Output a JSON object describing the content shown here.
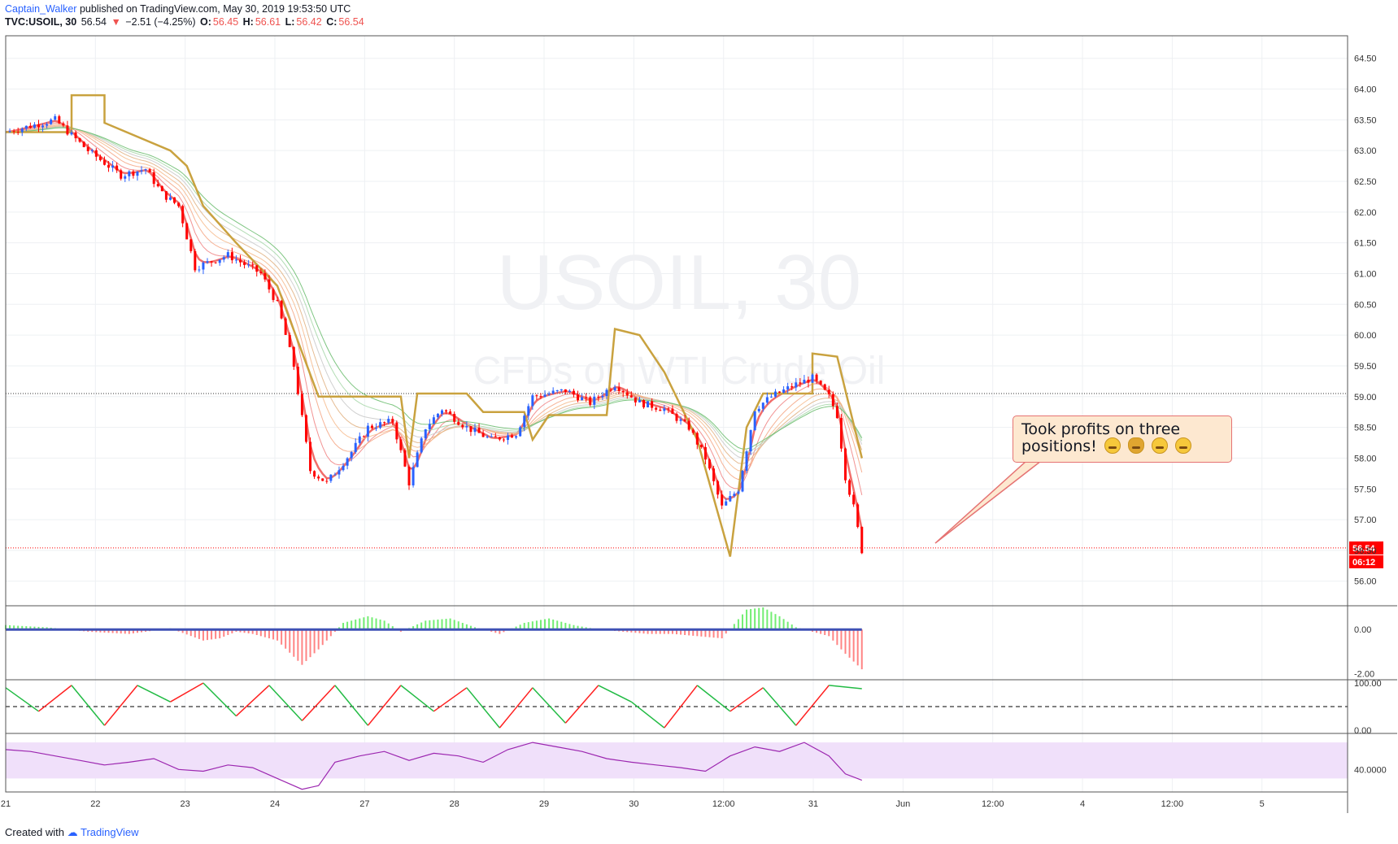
{
  "header": {
    "author": "Captain_Walker",
    "published": "published on TradingView.com, May 30, 2019 19:53:50 UTC",
    "symbol": "TVC:USOIL, 30",
    "last": "56.54",
    "change_arrow": "▼",
    "change": "−2.51 (−4.25%)",
    "open_label": "O:",
    "open": "56.45",
    "high_label": "H:",
    "high": "56.61",
    "low_label": "L:",
    "low": "56.42",
    "close_label": "C:",
    "close": "56.54"
  },
  "watermark": {
    "line1": "USOIL, 30",
    "line2": "CFDs on WTI Crude Oil"
  },
  "callout": {
    "text_line1": "Took profits on three",
    "text_line2": "positions!",
    "emojis": [
      "money-face-icon",
      "money-bag-icon",
      "laughing-face-icon",
      "grinning-face-icon"
    ]
  },
  "footer": {
    "created": "Created with",
    "brand": "TradingView"
  },
  "price_badges": {
    "last": "56.54",
    "countdown": "06:12"
  },
  "colors": {
    "up": "#2962ff",
    "down": "#ff0000",
    "last_price": "#ff0000",
    "rsi": "#9c27b0",
    "ribbon_fast": "#ef5350",
    "baseline": "#c9a23f"
  },
  "chart_data": [
    {
      "type": "candlestick",
      "title": "USOIL, 30",
      "xlabel": "",
      "ylabel": "",
      "x_ticks": [
        "21",
        "22",
        "23",
        "24",
        "27",
        "28",
        "29",
        "30",
        "12:00",
        "31",
        "Jun",
        "12:00",
        "4",
        "12:00",
        "5"
      ],
      "y_ticks": [
        "64.50",
        "64.00",
        "63.50",
        "63.00",
        "62.50",
        "62.00",
        "61.50",
        "61.00",
        "60.50",
        "60.00",
        "59.50",
        "59.00",
        "58.50",
        "58.00",
        "57.50",
        "57.00",
        "56.50",
        "56.00"
      ],
      "ylim": [
        55.6,
        64.8
      ],
      "grid": true,
      "reference_lines": [
        {
          "value": 59.05,
          "style": "dotted"
        },
        {
          "value": 56.54,
          "style": "dotted-red"
        }
      ],
      "price_path": [
        {
          "x": 0,
          "y": 63.3
        },
        {
          "x": 6,
          "y": 63.5
        },
        {
          "x": 10,
          "y": 63.0
        },
        {
          "x": 14,
          "y": 62.6
        },
        {
          "x": 17,
          "y": 62.7
        },
        {
          "x": 19,
          "y": 62.3
        },
        {
          "x": 21,
          "y": 62.1
        },
        {
          "x": 23,
          "y": 61.1
        },
        {
          "x": 27,
          "y": 61.3
        },
        {
          "x": 31,
          "y": 61.0
        },
        {
          "x": 33,
          "y": 60.5
        },
        {
          "x": 35,
          "y": 59.5
        },
        {
          "x": 37,
          "y": 57.8
        },
        {
          "x": 39,
          "y": 57.6
        },
        {
          "x": 42,
          "y": 58.1
        },
        {
          "x": 44,
          "y": 58.5
        },
        {
          "x": 47,
          "y": 58.6
        },
        {
          "x": 49,
          "y": 57.6
        },
        {
          "x": 51,
          "y": 58.5
        },
        {
          "x": 53,
          "y": 58.8
        },
        {
          "x": 56,
          "y": 58.5
        },
        {
          "x": 59,
          "y": 58.3
        },
        {
          "x": 62,
          "y": 58.4
        },
        {
          "x": 64,
          "y": 59.0
        },
        {
          "x": 68,
          "y": 59.1
        },
        {
          "x": 71,
          "y": 58.9
        },
        {
          "x": 74,
          "y": 59.2
        },
        {
          "x": 77,
          "y": 58.9
        },
        {
          "x": 80,
          "y": 58.8
        },
        {
          "x": 83,
          "y": 58.5
        },
        {
          "x": 85,
          "y": 58.0
        },
        {
          "x": 87,
          "y": 57.2
        },
        {
          "x": 89,
          "y": 57.5
        },
        {
          "x": 91,
          "y": 58.8
        },
        {
          "x": 93,
          "y": 59.0
        },
        {
          "x": 96,
          "y": 59.2
        },
        {
          "x": 98,
          "y": 59.3
        },
        {
          "x": 100,
          "y": 59.0
        },
        {
          "x": 101,
          "y": 58.7
        },
        {
          "x": 102,
          "y": 57.7
        },
        {
          "x": 103,
          "y": 57.2
        },
        {
          "x": 104,
          "y": 56.5
        }
      ],
      "baseline_path": [
        {
          "x": 0,
          "y": 63.3
        },
        {
          "x": 8,
          "y": 63.3
        },
        {
          "x": 8,
          "y": 63.9
        },
        {
          "x": 12,
          "y": 63.9
        },
        {
          "x": 12,
          "y": 63.45
        },
        {
          "x": 20,
          "y": 63.0
        },
        {
          "x": 22,
          "y": 62.75
        },
        {
          "x": 24,
          "y": 62.1
        },
        {
          "x": 28,
          "y": 61.5
        },
        {
          "x": 33,
          "y": 60.8
        },
        {
          "x": 38,
          "y": 59.0
        },
        {
          "x": 48,
          "y": 59.0
        },
        {
          "x": 49,
          "y": 58.0
        },
        {
          "x": 50,
          "y": 59.05
        },
        {
          "x": 56,
          "y": 59.05
        },
        {
          "x": 58,
          "y": 58.75
        },
        {
          "x": 63,
          "y": 58.75
        },
        {
          "x": 64,
          "y": 58.3
        },
        {
          "x": 66,
          "y": 58.7
        },
        {
          "x": 73,
          "y": 58.7
        },
        {
          "x": 74,
          "y": 60.1
        },
        {
          "x": 77,
          "y": 60.0
        },
        {
          "x": 80,
          "y": 59.4
        },
        {
          "x": 84,
          "y": 58.3
        },
        {
          "x": 88,
          "y": 56.4
        },
        {
          "x": 90,
          "y": 58.5
        },
        {
          "x": 92,
          "y": 59.05
        },
        {
          "x": 98,
          "y": 59.05
        },
        {
          "x": 98,
          "y": 59.7
        },
        {
          "x": 101,
          "y": 59.65
        },
        {
          "x": 104,
          "y": 58.0
        }
      ]
    },
    {
      "type": "bar",
      "title": "",
      "y_ticks": [
        "0.00",
        "-2.00"
      ],
      "ylim": [
        -2.2,
        1.0
      ],
      "x": [
        0,
        5,
        10,
        15,
        20,
        24,
        26,
        28,
        30,
        33,
        36,
        38,
        41,
        44,
        46,
        48,
        51,
        54,
        57,
        60,
        63,
        66,
        69,
        72,
        75,
        78,
        81,
        84,
        87,
        90,
        92,
        94,
        96,
        98,
        100,
        102,
        104
      ],
      "values": [
        0.2,
        0.1,
        -0.1,
        -0.2,
        0.05,
        -0.5,
        -0.4,
        -0.1,
        -0.2,
        -0.5,
        -1.6,
        -0.9,
        0.3,
        0.6,
        0.4,
        -0.1,
        0.4,
        0.5,
        0.1,
        -0.2,
        0.3,
        0.5,
        0.2,
        0.0,
        -0.1,
        -0.2,
        -0.2,
        -0.3,
        -0.4,
        0.9,
        1.0,
        0.6,
        0.1,
        -0.1,
        -0.3,
        -1.1,
        -1.8
      ]
    },
    {
      "type": "line",
      "title": "",
      "y_ticks": [
        "100.00",
        "0.00"
      ],
      "ylim": [
        0,
        100
      ],
      "reference_lines": [
        {
          "value": 50,
          "style": "dashed"
        }
      ],
      "series": [
        {
          "values_pattern": "sawtooth",
          "x": [
            0,
            4,
            8,
            12,
            16,
            20,
            24,
            28,
            32,
            36,
            40,
            44,
            48,
            52,
            56,
            60,
            64,
            68,
            72,
            76,
            80,
            84,
            88,
            92,
            96,
            100,
            104
          ],
          "values": [
            90,
            40,
            95,
            10,
            95,
            60,
            100,
            30,
            95,
            20,
            95,
            10,
            95,
            40,
            90,
            5,
            90,
            15,
            95,
            60,
            5,
            95,
            40,
            90,
            10,
            95,
            88
          ]
        }
      ]
    },
    {
      "type": "line",
      "title": "",
      "y_ticks": [
        "40.0000"
      ],
      "ylim": [
        15,
        80
      ],
      "band": [
        30,
        70
      ],
      "series": [
        {
          "x": [
            0,
            3,
            6,
            9,
            12,
            15,
            18,
            21,
            24,
            27,
            30,
            33,
            36,
            38,
            40,
            43,
            46,
            49,
            52,
            55,
            58,
            61,
            64,
            67,
            70,
            73,
            76,
            79,
            82,
            85,
            88,
            91,
            94,
            97,
            100,
            102,
            104
          ],
          "values": [
            62,
            60,
            55,
            50,
            45,
            48,
            52,
            40,
            38,
            45,
            42,
            30,
            18,
            22,
            48,
            55,
            60,
            50,
            58,
            55,
            48,
            62,
            70,
            65,
            60,
            52,
            48,
            45,
            42,
            38,
            55,
            65,
            60,
            70,
            55,
            35,
            28
          ]
        }
      ]
    }
  ]
}
